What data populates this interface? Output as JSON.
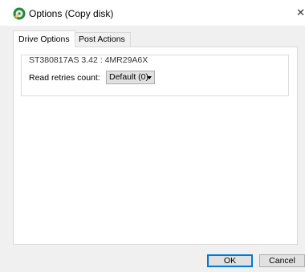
{
  "window": {
    "title": "Options (Copy disk)",
    "icon": "app-disk-icon",
    "close_glyph": "✕"
  },
  "tabs": [
    {
      "label": "Drive Options",
      "active": true
    },
    {
      "label": "Post Actions",
      "active": false
    }
  ],
  "drive_options": {
    "drive_name": "ST380817AS 3.42 : 4MR29A6X",
    "read_retries_label": "Read retries count:",
    "read_retries_value": "Default (0)"
  },
  "buttons": {
    "ok_label": "OK",
    "cancel_label": "Cancel"
  },
  "colors": {
    "accent": "#0078d7",
    "dialog_bg": "#f0f0f0",
    "panel_bg": "#ffffff"
  }
}
